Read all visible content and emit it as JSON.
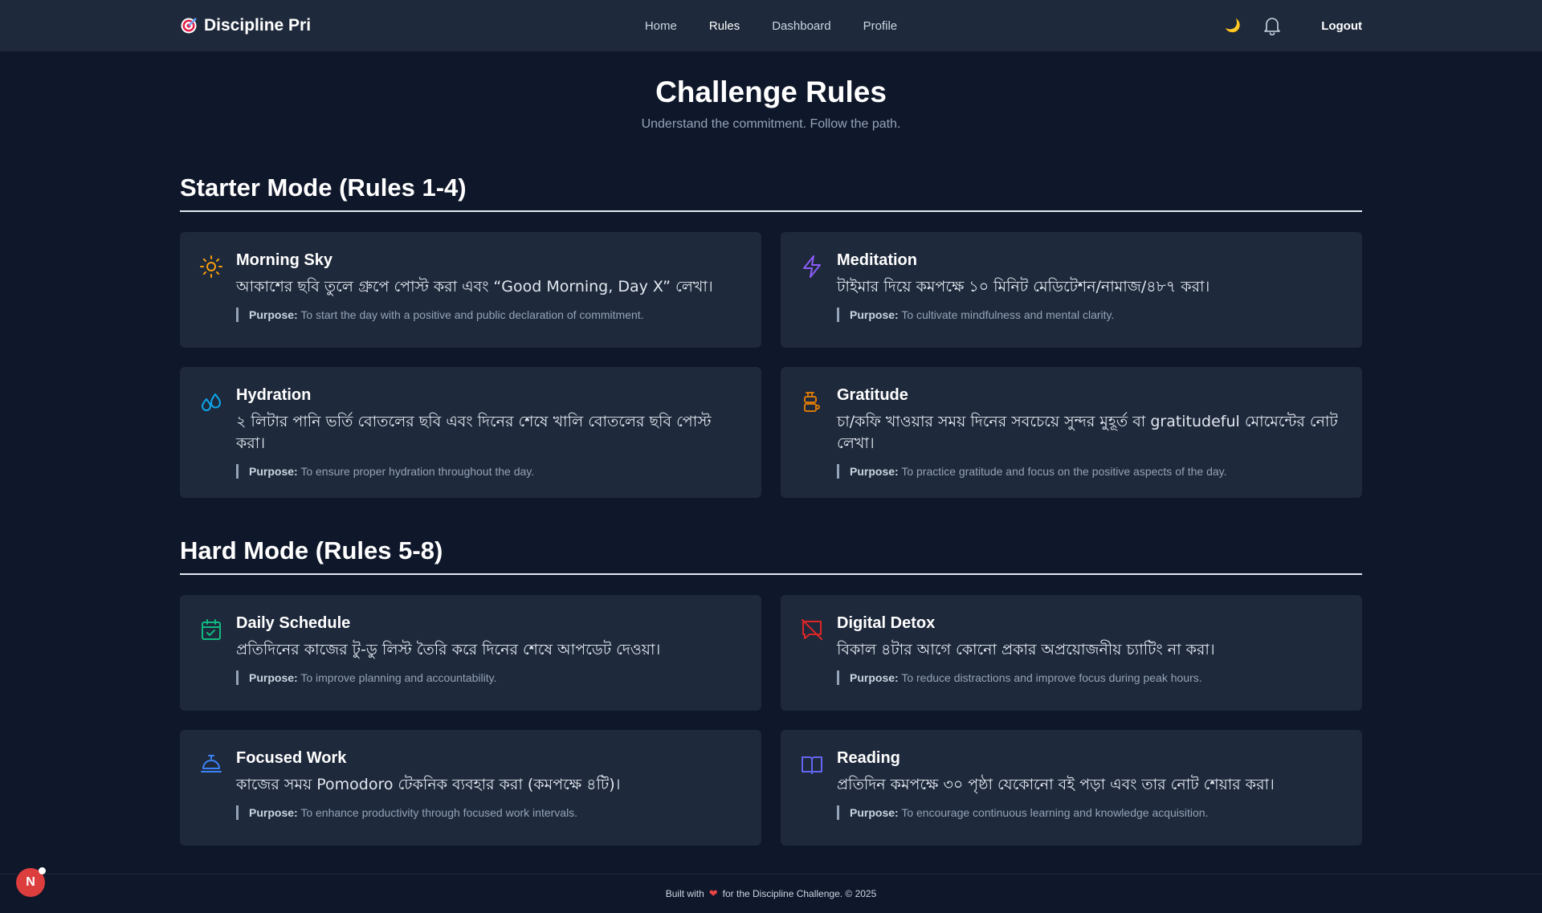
{
  "nav": {
    "brand": "Discipline Pri",
    "links": [
      "Home",
      "Rules",
      "Dashboard",
      "Profile"
    ],
    "active": "Rules",
    "theme_icon": "moon-icon",
    "logout": "Logout"
  },
  "header": {
    "title": "Challenge Rules",
    "subtitle": "Understand the commitment. Follow the path."
  },
  "purpose_label": "Purpose:",
  "sections": [
    {
      "title": "Starter Mode (Rules 1-4)",
      "rules": [
        {
          "icon": "sun-icon",
          "color": "#f59e0b",
          "title": "Morning Sky",
          "desc": "আকাশের ছবি তুলে গ্রুপে পোস্ট করা এবং “Good Morning, Day X” লেখা।",
          "purpose": "To start the day with a positive and public declaration of commitment."
        },
        {
          "icon": "lightning-icon",
          "color": "#8b5cf6",
          "title": "Meditation",
          "desc": "টাইমার দিয়ে কমপক্ষে ১০ মিনিট মেডিটেশন/নামাজ/৪৮৭ করা।",
          "purpose": "To cultivate mindfulness and mental clarity."
        },
        {
          "icon": "water-drops-icon",
          "color": "#0ea5e9",
          "title": "Hydration",
          "desc": "২ লিটার পানি ভর্তি বোতলের ছবি এবং দিনের শেষে খালি বোতলের ছবি পোস্ট করা।",
          "purpose": "To ensure proper hydration throughout the day."
        },
        {
          "icon": "coffee-icon",
          "color": "#d97706",
          "title": "Gratitude",
          "desc": "চা/কফি খাওয়ার সময় দিনের সবচেয়ে সুন্দর মুহূর্ত বা gratitudeful মোমেন্টের নোট লেখা।",
          "purpose": "To practice gratitude and focus on the positive aspects of the day."
        }
      ]
    },
    {
      "title": "Hard Mode (Rules 5-8)",
      "rules": [
        {
          "icon": "calendar-check-icon",
          "color": "#10b981",
          "title": "Daily Schedule",
          "desc": "প্রতিদিনের কাজের টু-ডু লিস্ট তৈরি করে দিনের শেষে আপডেট দেওয়া।",
          "purpose": "To improve planning and accountability."
        },
        {
          "icon": "no-message-icon",
          "color": "#dc2626",
          "title": "Digital Detox",
          "desc": "বিকাল ৪টার আগে কোনো প্রকার অপ্রয়োজনীয় চ্যাটিং না করা।",
          "purpose": "To reduce distractions and improve focus during peak hours."
        },
        {
          "icon": "timer-bell-icon",
          "color": "#3b82f6",
          "title": "Focused Work",
          "desc": "কাজের সময় Pomodoro টেকনিক ব্যবহার করা (কমপক্ষে ৪টি)।",
          "purpose": "To enhance productivity through focused work intervals."
        },
        {
          "icon": "book-icon",
          "color": "#6366f1",
          "title": "Reading",
          "desc": "প্রতিদিন কমপক্ষে ৩০ পৃষ্ঠা যেকোনো বই পড়া এবং তার নোট শেয়ার করা।",
          "purpose": "To encourage continuous learning and knowledge acquisition."
        }
      ]
    }
  ],
  "footer": {
    "before": "Built with",
    "after": "for the Discipline Challenge. © 2025"
  },
  "badge": "N"
}
